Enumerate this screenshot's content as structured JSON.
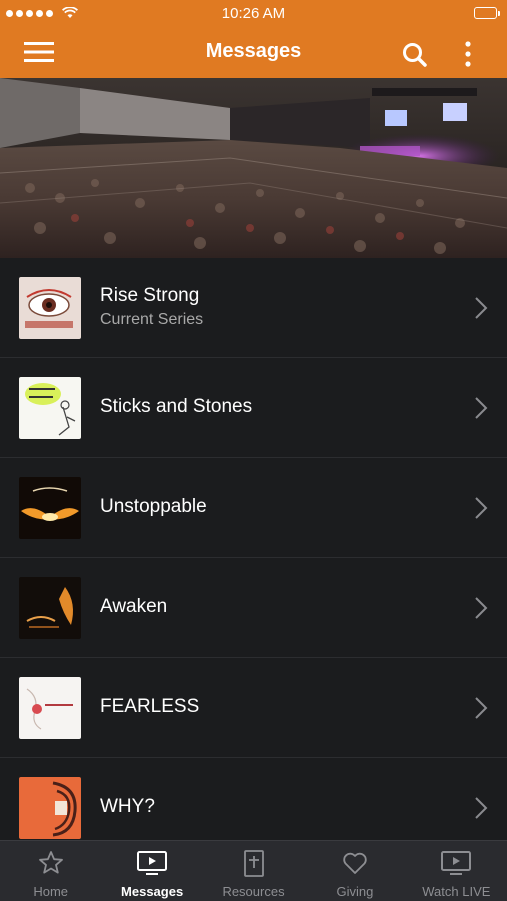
{
  "status_bar": {
    "time": "10:26 AM"
  },
  "header": {
    "title": "Messages"
  },
  "list": {
    "items": [
      {
        "title": "Rise Strong",
        "subtitle": "Current Series"
      },
      {
        "title": "Sticks and Stones"
      },
      {
        "title": "Unstoppable"
      },
      {
        "title": "Awaken"
      },
      {
        "title": "FEARLESS"
      },
      {
        "title": "WHY?"
      }
    ]
  },
  "tabs": [
    {
      "label": "Home",
      "icon": "star-icon"
    },
    {
      "label": "Messages",
      "icon": "tv-play-icon",
      "active": true
    },
    {
      "label": "Resources",
      "icon": "bible-icon"
    },
    {
      "label": "Giving",
      "icon": "heart-icon"
    },
    {
      "label": "Watch LIVE",
      "icon": "tv-play-icon"
    }
  ],
  "colors": {
    "brand": "#e07a22",
    "background": "#1b1c1e",
    "tabbar": "#2a2b2f"
  }
}
